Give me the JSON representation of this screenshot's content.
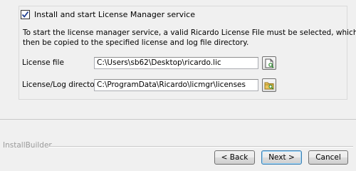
{
  "service": {
    "checkbox_label": "Install and start License Manager service",
    "checked": true
  },
  "description": {
    "line1": "To start the license manager service, a valid Ricardo License File must be selected, which will",
    "line2": "then be copied to the specified license and log file directory."
  },
  "license_file": {
    "label": "License file",
    "value": "C:\\Users\\sb62\\Desktop\\ricardo.lic",
    "browse_icon": "file-browse-icon"
  },
  "license_log_dir": {
    "label": "License/Log directory",
    "value": "C:\\ProgramData\\Ricardo\\licmgr\\licenses",
    "browse_icon": "folder-browse-icon"
  },
  "footer": {
    "brand": "InstallBuilder",
    "back_label": "< Back",
    "next_label": "Next >",
    "cancel_label": "Cancel"
  },
  "colors": {
    "window_bg": "#f0f0f0",
    "default_button_border": "#3c7fb1",
    "brand_text": "#9a9a9a"
  }
}
